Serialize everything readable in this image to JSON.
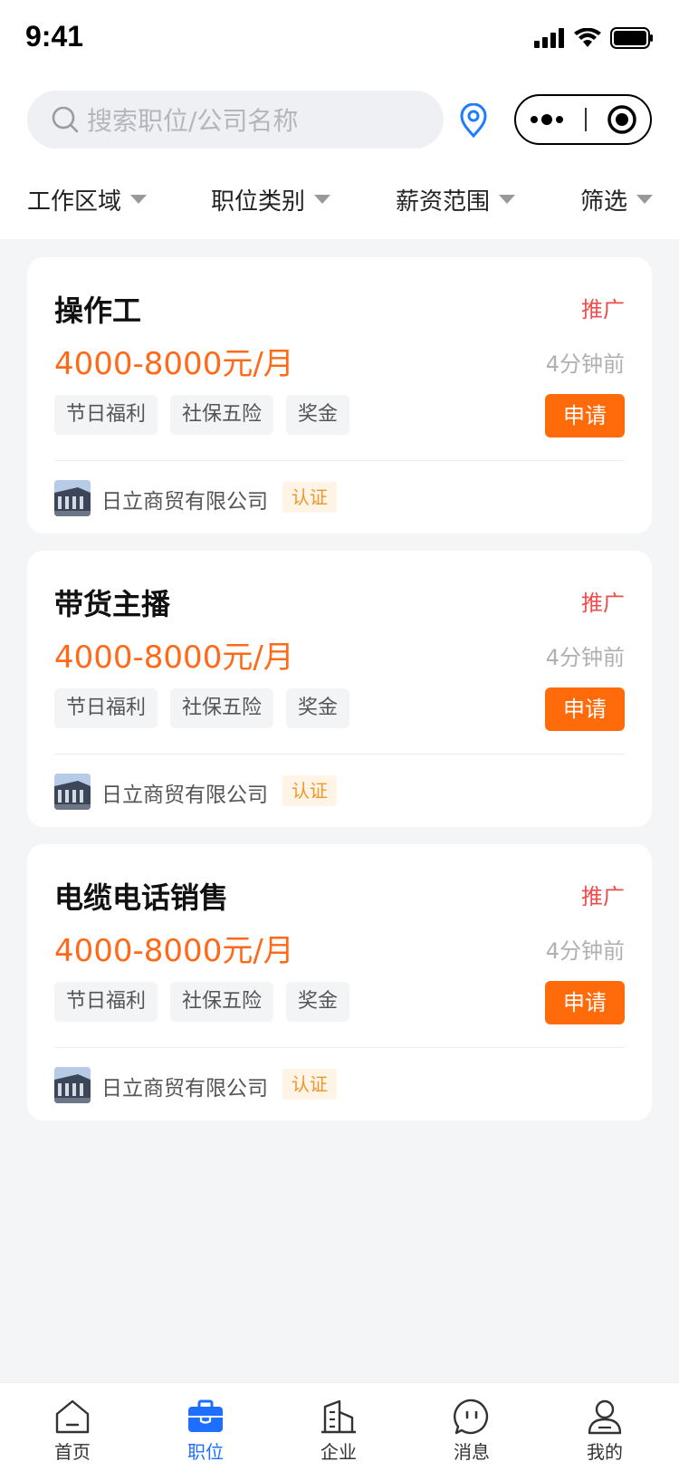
{
  "status_bar": {
    "time": "9:41"
  },
  "search": {
    "placeholder": "搜索职位/公司名称"
  },
  "filters": [
    {
      "label": "工作区域"
    },
    {
      "label": "职位类别"
    },
    {
      "label": "薪资范围"
    },
    {
      "label": "筛选"
    }
  ],
  "jobs": [
    {
      "title": "操作工",
      "promo": "推广",
      "salary": "4000-8000元/月",
      "time": "4分钟前",
      "tags": [
        "节日福利",
        "社保五险",
        "奖金"
      ],
      "apply": "申请",
      "company": "日立商贸有限公司",
      "cert": "认证"
    },
    {
      "title": "带货主播",
      "promo": "推广",
      "salary": "4000-8000元/月",
      "time": "4分钟前",
      "tags": [
        "节日福利",
        "社保五险",
        "奖金"
      ],
      "apply": "申请",
      "company": "日立商贸有限公司",
      "cert": "认证"
    },
    {
      "title": "电缆电话销售",
      "promo": "推广",
      "salary": "4000-8000元/月",
      "time": "4分钟前",
      "tags": [
        "节日福利",
        "社保五险",
        "奖金"
      ],
      "apply": "申请",
      "company": "日立商贸有限公司",
      "cert": "认证"
    }
  ],
  "tabbar": [
    {
      "label": "首页",
      "icon": "home-icon"
    },
    {
      "label": "职位",
      "icon": "briefcase-icon",
      "active": true
    },
    {
      "label": "企业",
      "icon": "building-icon"
    },
    {
      "label": "消息",
      "icon": "chat-icon"
    },
    {
      "label": "我的",
      "icon": "user-icon"
    }
  ],
  "colors": {
    "accent": "#ff6a0a",
    "salary": "#ff6a1a",
    "promo": "#f04c4c",
    "tab_active": "#1f6fff",
    "cert_text": "#f0962b"
  }
}
